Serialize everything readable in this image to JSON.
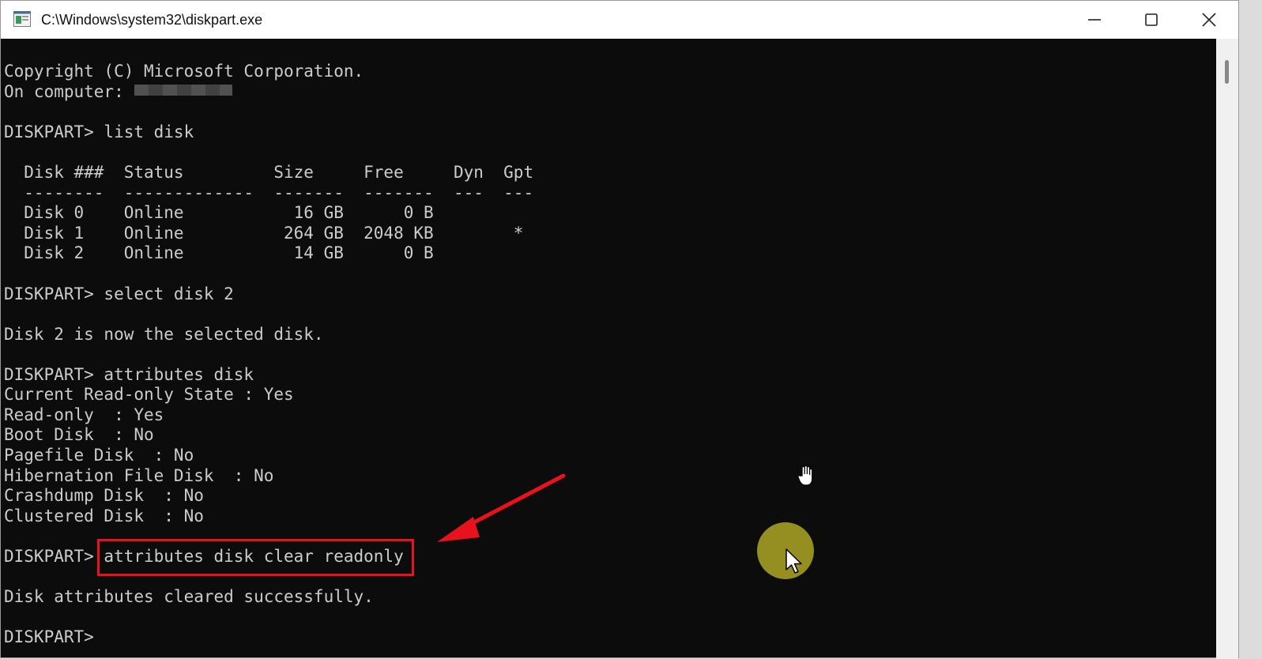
{
  "window": {
    "title": "C:\\Windows\\system32\\diskpart.exe",
    "controls": {
      "minimize": "minimize-icon",
      "maximize": "maximize-icon",
      "close": "close-icon"
    }
  },
  "console": {
    "lines": [
      "Copyright (C) Microsoft Corporation.",
      "On computer:",
      "",
      "DISKPART> list disk",
      "",
      "  Disk ###  Status         Size     Free     Dyn  Gpt",
      "  --------  -------------  -------  -------  ---  ---",
      "  Disk 0    Online           16 GB      0 B",
      "  Disk 1    Online          264 GB  2048 KB        *",
      "  Disk 2    Online           14 GB      0 B",
      "",
      "DISKPART> select disk 2",
      "",
      "Disk 2 is now the selected disk.",
      "",
      "DISKPART> attributes disk",
      "Current Read-only State : Yes",
      "Read-only  : Yes",
      "Boot Disk  : No",
      "Pagefile Disk  : No",
      "Hibernation File Disk  : No",
      "Crashdump Disk  : No",
      "Clustered Disk  : No",
      "",
      "DISKPART> attributes disk clear readonly",
      "",
      "Disk attributes cleared successfully.",
      "",
      "DISKPART>"
    ]
  },
  "colors": {
    "console_bg": "#0c0c0c",
    "console_text": "#cccccc",
    "annotation_red": "#e8121c"
  },
  "icons": {
    "app": "console-app-icon",
    "hand_cursor": "hand-cursor-icon",
    "arrow_cursor": "arrow-cursor-icon",
    "annotation_arrow": "red-arrow-icon"
  }
}
